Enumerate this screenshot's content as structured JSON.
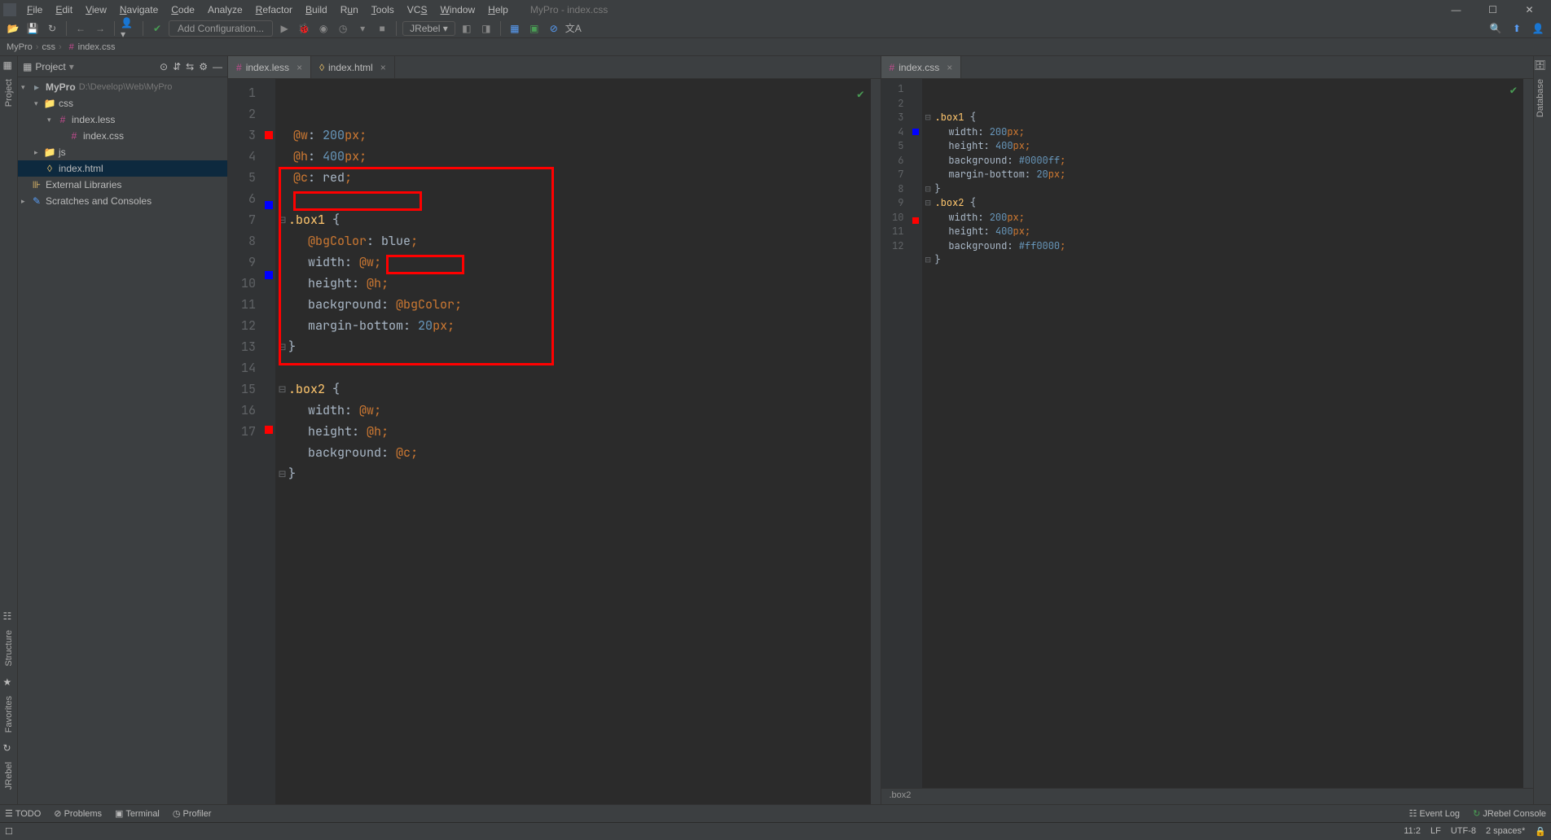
{
  "window": {
    "title": "MyPro - index.css"
  },
  "menu": [
    {
      "label": "File",
      "u": 0
    },
    {
      "label": "Edit",
      "u": 0
    },
    {
      "label": "View",
      "u": 0
    },
    {
      "label": "Navigate",
      "u": 0
    },
    {
      "label": "Code",
      "u": 0
    },
    {
      "label": "Analyze",
      "u": -1
    },
    {
      "label": "Refactor",
      "u": 0
    },
    {
      "label": "Build",
      "u": 0
    },
    {
      "label": "Run",
      "u": 1
    },
    {
      "label": "Tools",
      "u": 0
    },
    {
      "label": "VCS",
      "u": -1
    },
    {
      "label": "Window",
      "u": 0
    },
    {
      "label": "Help",
      "u": 0
    }
  ],
  "toolbar": {
    "add_config": "Add Configuration...",
    "jrebel": "JRebel"
  },
  "breadcrumbs": [
    "MyPro",
    "css",
    "index.css"
  ],
  "project_panel": {
    "title": "Project",
    "root": {
      "label": "MyPro",
      "path": "D:\\Develop\\Web\\MyPro"
    },
    "css_folder": "css",
    "index_less": "index.less",
    "index_css": "index.css",
    "js_folder": "js",
    "index_html": "index.html",
    "ext_lib": "External Libraries",
    "scratches": "Scratches and Consoles"
  },
  "editor_left": {
    "tabs": [
      {
        "label": "index.less",
        "active": true
      },
      {
        "label": "index.html",
        "active": false
      }
    ],
    "line_numbers": [
      "1",
      "2",
      "3",
      "4",
      "5",
      "6",
      "7",
      "8",
      "9",
      "10",
      "11",
      "12",
      "13",
      "14",
      "15",
      "16",
      "17"
    ],
    "markers": {
      "3": "red",
      "6": "blue",
      "9": "blue",
      "16": "red"
    },
    "code": {
      "l1": {
        "a": "@w",
        "b": ": ",
        "c": "200",
        "d": "px",
        "e": ";"
      },
      "l2": {
        "a": "@h",
        "b": ": ",
        "c": "400",
        "d": "px",
        "e": ";"
      },
      "l3": {
        "a": "@c",
        "b": ": ",
        "c": "red",
        "d": ";"
      },
      "l5": {
        "a": ".box1 ",
        "b": "{"
      },
      "l6": {
        "a": "@bgColor",
        "b": ": ",
        "c": "blue",
        "d": ";"
      },
      "l7": {
        "a": "width",
        "b": ": ",
        "c": "@w",
        "d": ";"
      },
      "l8": {
        "a": "height",
        "b": ": ",
        "c": "@h",
        "d": ";"
      },
      "l9": {
        "a": "background",
        "b": ": ",
        "c": "@bgColor",
        "d": ";"
      },
      "l10": {
        "a": "margin-bottom",
        "b": ": ",
        "c": "20",
        "d": "px",
        "e": ";"
      },
      "l11": {
        "a": "}"
      },
      "l13": {
        "a": ".box2 ",
        "b": "{"
      },
      "l14": {
        "a": "width",
        "b": ": ",
        "c": "@w",
        "d": ";"
      },
      "l15": {
        "a": "height",
        "b": ": ",
        "c": "@h",
        "d": ";"
      },
      "l16": {
        "a": "background",
        "b": ": ",
        "c": "@c",
        "d": ";"
      },
      "l17": {
        "a": "}"
      }
    }
  },
  "editor_right": {
    "tabs": [
      {
        "label": "index.css",
        "active": true
      }
    ],
    "line_numbers": [
      "1",
      "2",
      "3",
      "4",
      "5",
      "6",
      "7",
      "8",
      "9",
      "10",
      "11",
      "12"
    ],
    "markers": {
      "4": "blue",
      "10": "red"
    },
    "code": {
      "l1": {
        "a": ".box1 ",
        "b": "{"
      },
      "l2": {
        "a": "width",
        "b": ": ",
        "c": "200",
        "d": "px",
        "e": ";"
      },
      "l3": {
        "a": "height",
        "b": ": ",
        "c": "400",
        "d": "px",
        "e": ";"
      },
      "l4": {
        "a": "background",
        "b": ": ",
        "c": "#0000ff",
        "d": ";"
      },
      "l5": {
        "a": "margin-bottom",
        "b": ": ",
        "c": "20",
        "d": "px",
        "e": ";"
      },
      "l6": {
        "a": "}"
      },
      "l7": {
        "a": ".box2 ",
        "b": "{"
      },
      "l8": {
        "a": "width",
        "b": ": ",
        "c": "200",
        "d": "px",
        "e": ";"
      },
      "l9": {
        "a": "height",
        "b": ": ",
        "c": "400",
        "d": "px",
        "e": ";"
      },
      "l10": {
        "a": "background",
        "b": ": ",
        "c": "#ff0000",
        "d": ";"
      },
      "l11": {
        "a": "}"
      }
    },
    "crumb": ".box2"
  },
  "left_gutter": {
    "project": "Project",
    "structure": "Structure",
    "favorites": "Favorites",
    "jrebel": "JRebel"
  },
  "right_gutter": {
    "database": "Database"
  },
  "bottom": {
    "todo": "TODO",
    "problems": "Problems",
    "terminal": "Terminal",
    "profiler": "Profiler",
    "event_log": "Event Log",
    "jrebel_console": "JRebel Console"
  },
  "status": {
    "pos": "11:2",
    "le": "LF",
    "enc": "UTF-8",
    "indent": "2 spaces*"
  }
}
